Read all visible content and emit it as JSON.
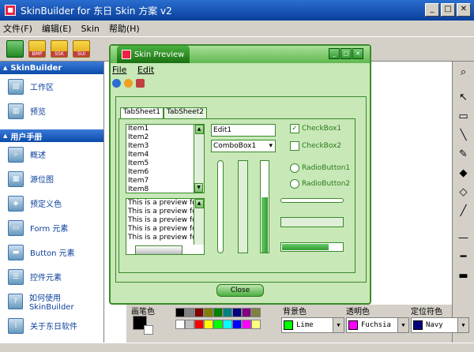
{
  "window": {
    "title": "SkinBuilder for 东日 Skin 方案 v2"
  },
  "menu": [
    "文件(F)",
    "编辑(E)",
    "Skin",
    "帮助(H)"
  ],
  "toolbar": {
    "folders": [
      "BMP",
      "SSK",
      "SUI"
    ]
  },
  "sidebar": {
    "section1": "SkinBuilder",
    "items1": [
      "工作区",
      "预览"
    ],
    "section2": "用户手册",
    "items2": [
      "概述",
      "源位图",
      "预定义色",
      "Form 元素",
      "Button 元素",
      "控件元素",
      "如何使用 SkinBuilder",
      "关于东日软件"
    ]
  },
  "preview": {
    "title": "Skin Preview",
    "menu": [
      "File",
      "Edit"
    ],
    "tabs": [
      "TabSheet1",
      "TabSheet2"
    ],
    "list_items": [
      "Item1",
      "Item2",
      "Item3",
      "Item4",
      "Item5",
      "Item6",
      "Item7",
      "Item8"
    ],
    "memo_lines": [
      "This is a preview for",
      "This is a preview for",
      "This is a preview for",
      "This is a preview for",
      "This is a preview for"
    ],
    "edit": "Edit1",
    "combo": "ComboBox1",
    "checkbox1": "CheckBox1",
    "checkbox2": "CheckBox2",
    "radio1": "RadioButton1",
    "radio2": "RadioButton2",
    "close": "Close"
  },
  "colors": {
    "pen_label": "画笔色",
    "bg_label": "背景色",
    "trans_label": "透明色",
    "loc_label": "定位符色",
    "bg_value": "Lime",
    "trans_value": "Fuchsia",
    "loc_value": "Navy",
    "palette": [
      "#000000",
      "#808080",
      "#800000",
      "#808000",
      "#008000",
      "#008080",
      "#000080",
      "#800080",
      "#808040",
      "#ffffff",
      "#c0c0c0",
      "#ff0000",
      "#ffff00",
      "#00ff00",
      "#00ffff",
      "#0000ff",
      "#ff00ff",
      "#ffff80"
    ]
  }
}
